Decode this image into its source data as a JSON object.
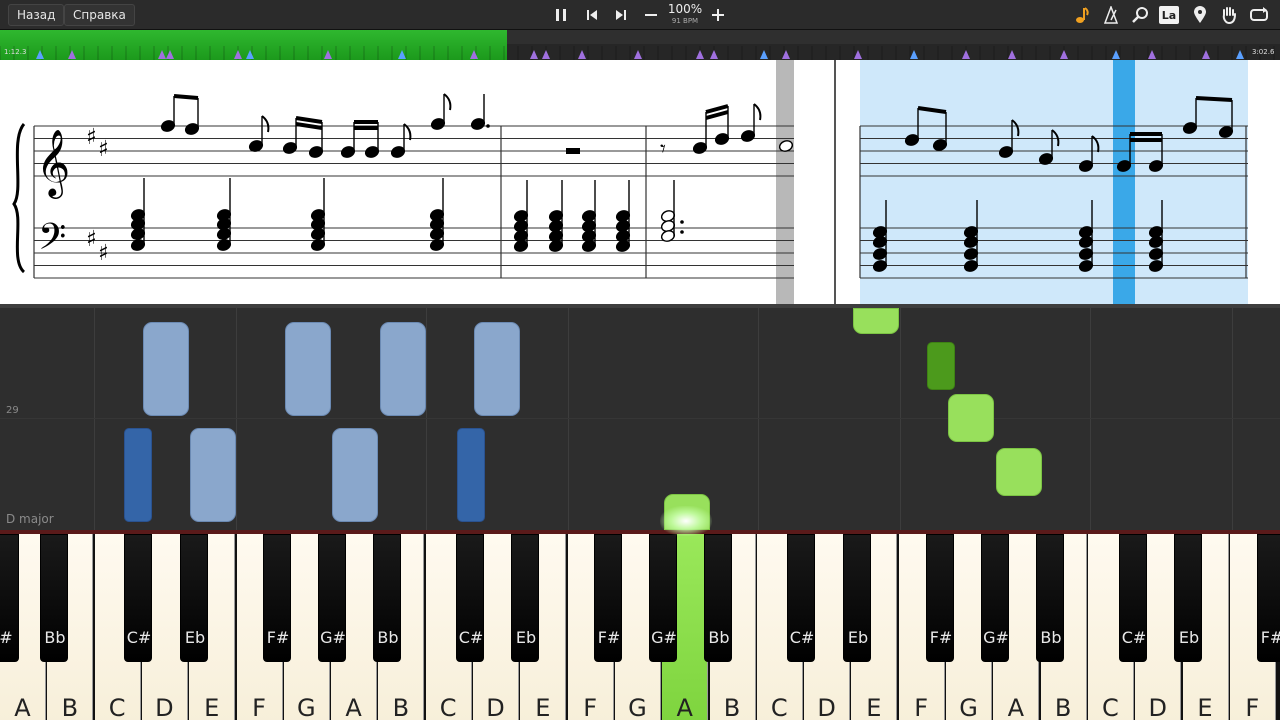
{
  "toolbar": {
    "back_label": "Назад",
    "help_label": "Справка",
    "zoom": "100%",
    "bpm": "91 BPM",
    "la_label": "La",
    "icons": [
      "pause-icon",
      "skip-back-icon",
      "skip-forward-icon",
      "minus-icon",
      "plus-icon",
      "note-icon",
      "metronome-icon",
      "search-icon",
      "la-icon",
      "location-pin-icon",
      "hand-icon",
      "loop-icon"
    ]
  },
  "timeline": {
    "current_time": "1:12.3",
    "total_time": "3:02.6",
    "progress_fraction": 0.396
  },
  "piano_roll": {
    "row_label": "29",
    "key_label": "D major"
  },
  "keyboard": {
    "white_keys": [
      "A",
      "B",
      "C",
      "D",
      "E",
      "F",
      "G",
      "A",
      "B",
      "C",
      "D",
      "E",
      "F",
      "G",
      "A",
      "B",
      "C",
      "D",
      "E",
      "F",
      "G",
      "A",
      "B",
      "C",
      "D",
      "E",
      "F"
    ],
    "black_keys": [
      "#",
      "Bb",
      "C#",
      "Eb",
      "F#",
      "G#",
      "Bb",
      "C#",
      "Eb",
      "F#",
      "G#",
      "Bb",
      "C#",
      "Eb",
      "F#",
      "G#",
      "Bb",
      "C#",
      "Eb",
      "F#"
    ],
    "active_key": "A"
  },
  "colors": {
    "progress": "#2fb82f",
    "left_hand": "#8aa7cc",
    "left_hand_dark": "#3465a8",
    "right_hand": "#98e05c",
    "right_hand_dark": "#4c9a1c",
    "highlight": "#cfe8fa",
    "cursor": "#3aa8e8"
  }
}
